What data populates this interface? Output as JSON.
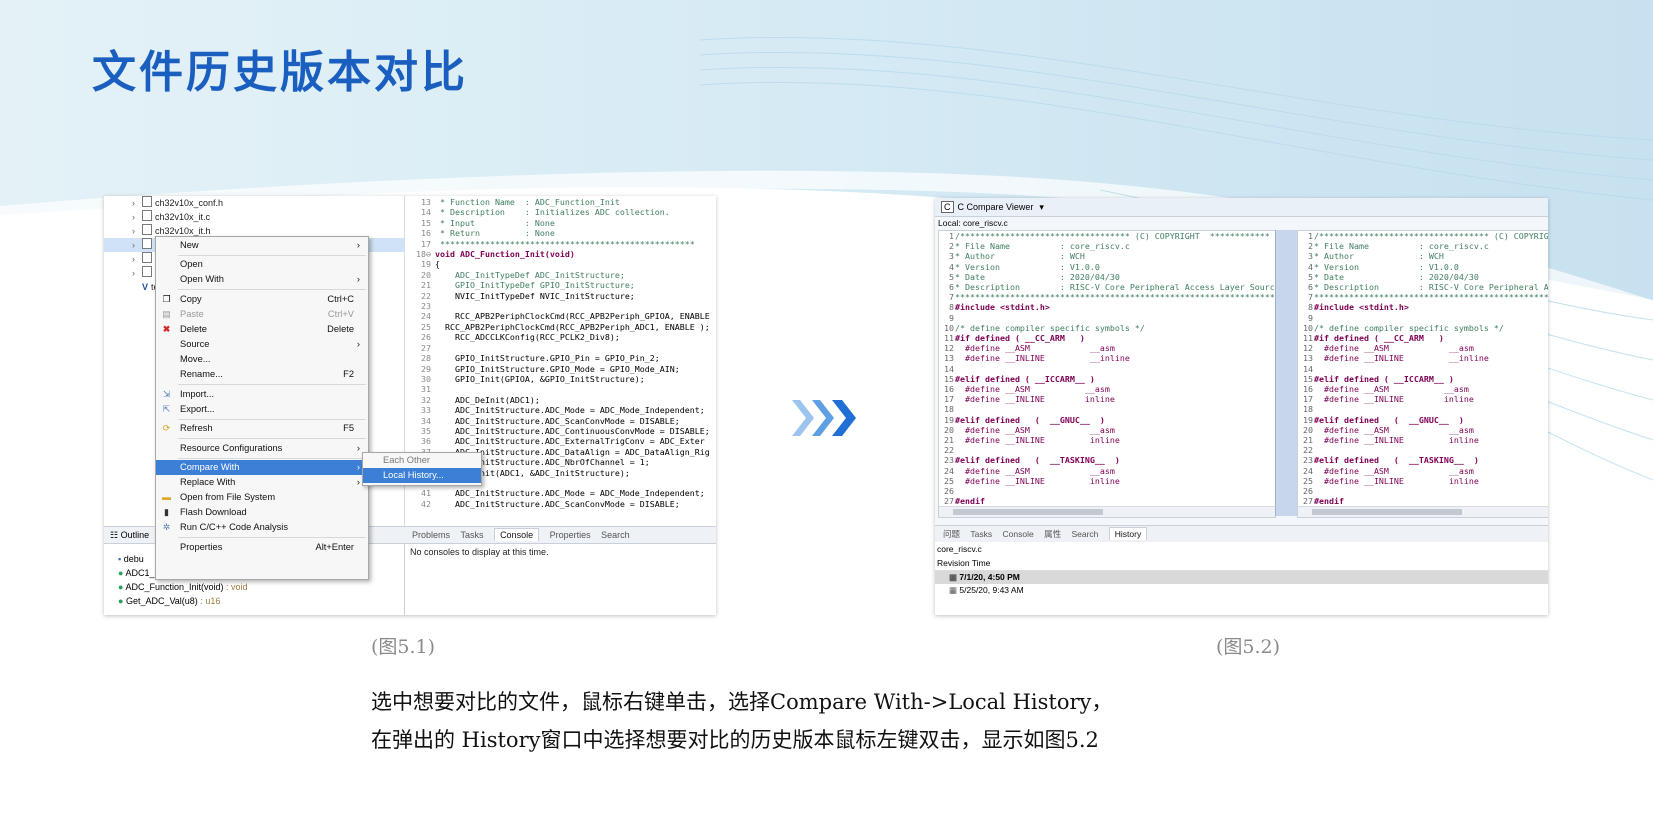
{
  "slide": {
    "title": "文件历史版本对比",
    "caption_left": "(图5.1)",
    "caption_right": "(图5.2)",
    "description_line1": "选中想要对比的文件，鼠标右键单击，选择Compare With->Local History，",
    "description_line2": "在弹出的 History窗口中选择想要对比的历史版本鼠标左键双击，显示如图5.2"
  },
  "shot1": {
    "tree_items": [
      "ch32v10x_conf.h",
      "ch32v10x_it.c",
      "ch32v10x_it.h",
      "r",
      "s",
      "s",
      "tem"
    ],
    "context_menu": {
      "new": "New",
      "open": "Open",
      "open_with": "Open With",
      "copy": "Copy",
      "copy_sc": "Ctrl+C",
      "paste": "Paste",
      "paste_sc": "Ctrl+V",
      "delete": "Delete",
      "delete_sc": "Delete",
      "source": "Source",
      "move": "Move...",
      "rename": "Rename...",
      "rename_sc": "F2",
      "import": "Import...",
      "export": "Export...",
      "refresh": "Refresh",
      "refresh_sc": "F5",
      "resource_configs": "Resource Configurations",
      "compare_with": "Compare With",
      "replace_with": "Replace With",
      "open_file_system": "Open from File System",
      "flash_download": "Flash Download",
      "run_analysis": "Run C/C++ Code Analysis",
      "properties": "Properties",
      "properties_sc": "Alt+Enter"
    },
    "submenu": {
      "each_other": "Each Other",
      "local_history": "Local History..."
    },
    "bottom_tabs": {
      "problems": "Problems",
      "tasks": "Tasks",
      "console": "Console",
      "properties": "Properties",
      "search": "Search"
    },
    "console_message": "No consoles to display at this time.",
    "outline": {
      "title": "Outline",
      "items": [
        {
          "name": "debu",
          "type": ""
        },
        {
          "name": "ADC1_2_IRQHandler(void)",
          "type": " : void"
        },
        {
          "name": "ADC_Function_Init(void)",
          "type": " : void"
        },
        {
          "name": "Get_ADC_Val(u8)",
          "type": " : u16"
        }
      ]
    },
    "code": [
      {
        "n": "13",
        "t": "cm",
        "text": " * Function Name  : ADC_Function_Init"
      },
      {
        "n": "14",
        "t": "cm",
        "text": " * Description    : Initializes ADC collection."
      },
      {
        "n": "15",
        "t": "cm",
        "text": " * Input          : None"
      },
      {
        "n": "16",
        "t": "cm",
        "text": " * Return         : None"
      },
      {
        "n": "17",
        "t": "cm",
        "text": " ***************************************************"
      },
      {
        "n": "18⊖",
        "t": "kw",
        "text": "void ADC_Function_Init(void)"
      },
      {
        "n": "19",
        "t": "",
        "text": "{"
      },
      {
        "n": "20",
        "t": "cm2",
        "text": "    ADC_InitTypeDef ADC_InitStructure;"
      },
      {
        "n": "21",
        "t": "cm2",
        "text": "    GPIO_InitTypeDef GPIO_InitStructure;"
      },
      {
        "n": "22",
        "t": "",
        "text": "    NVIC_InitTypeDef NVIC_InitStructure;"
      },
      {
        "n": "23",
        "t": "",
        "text": ""
      },
      {
        "n": "24",
        "t": "",
        "text": "    RCC_APB2PeriphClockCmd(RCC_APB2Periph_GPIOA, ENABLE"
      },
      {
        "n": "25",
        "t": "",
        "text": "  RCC_APB2PeriphClockCmd(RCC_APB2Periph_ADC1, ENABLE );"
      },
      {
        "n": "26",
        "t": "",
        "text": "    RCC_ADCCLKConfig(RCC_PCLK2_Div8);"
      },
      {
        "n": "27",
        "t": "",
        "text": ""
      },
      {
        "n": "28",
        "t": "",
        "text": "    GPIO_InitStructure.GPIO_Pin = GPIO_Pin_2;"
      },
      {
        "n": "29",
        "t": "",
        "text": "    GPIO_InitStructure.GPIO_Mode = GPIO_Mode_AIN;"
      },
      {
        "n": "30",
        "t": "",
        "text": "    GPIO_Init(GPIOA, &GPIO_InitStructure);"
      },
      {
        "n": "31",
        "t": "",
        "text": ""
      },
      {
        "n": "32",
        "t": "",
        "text": "    ADC_DeInit(ADC1);"
      },
      {
        "n": "33",
        "t": "",
        "text": "    ADC_InitStructure.ADC_Mode = ADC_Mode_Independent;"
      },
      {
        "n": "34",
        "t": "",
        "text": "    ADC_InitStructure.ADC_ScanConvMode = DISABLE;"
      },
      {
        "n": "35",
        "t": "",
        "text": "    ADC_InitStructure.ADC_ContinuousConvMode = DISABLE;"
      },
      {
        "n": "36",
        "t": "",
        "text": "    ADC_InitStructure.ADC_ExternalTrigConv = ADC_Exter"
      },
      {
        "n": "37",
        "t": "",
        "text": "    ADC_InitStructure.ADC_DataAlign = ADC_DataAlign_Rig"
      },
      {
        "n": "38",
        "t": "",
        "text": "    ADC_InitStructure.ADC_NbrOfChannel = 1;"
      },
      {
        "n": "39",
        "t": "",
        "text": "    ADC_Init(ADC1, &ADC_InitStructure);"
      },
      {
        "n": "40",
        "t": "",
        "text": ""
      },
      {
        "n": "41",
        "t": "",
        "text": "    ADC_InitStructure.ADC_Mode = ADC_Mode_Independent;"
      },
      {
        "n": "42",
        "t": "",
        "text": "    ADC_InitStructure.ADC_ScanConvMode = DISABLE;"
      }
    ]
  },
  "shot2": {
    "viewer_title": "C Compare Viewer",
    "local_label": "Local: core_riscv.c",
    "code": [
      {
        "n": "1",
        "t": "cm",
        "text": "/********************************** (C) COPYRIGHT  ************"
      },
      {
        "n": "2",
        "t": "cm",
        "text": "* File Name          : core_riscv.c"
      },
      {
        "n": "3",
        "t": "cm",
        "text": "* Author             : WCH"
      },
      {
        "n": "4",
        "t": "cm",
        "text": "* Version            : V1.0.0"
      },
      {
        "n": "5",
        "t": "cm",
        "text": "* Date               : 2020/04/30"
      },
      {
        "n": "6",
        "t": "cm",
        "text": "* Description        : RISC-V Core Peripheral Access Layer Source"
      },
      {
        "n": "7",
        "t": "cm",
        "text": "*****************************************************************"
      },
      {
        "n": "8",
        "t": "inc",
        "text": "#include <stdint.h>"
      },
      {
        "n": "9",
        "t": "",
        "text": ""
      },
      {
        "n": "10",
        "t": "cm",
        "text": "/* define compiler specific symbols */"
      },
      {
        "n": "11",
        "t": "pp",
        "text": "#if defined ( __CC_ARM   )"
      },
      {
        "n": "12",
        "t": "def",
        "text": "  #define __ASM            __asm"
      },
      {
        "n": "13",
        "t": "def",
        "text": "  #define __INLINE         __inline"
      },
      {
        "n": "14",
        "t": "",
        "text": ""
      },
      {
        "n": "15",
        "t": "pp",
        "text": "#elif defined ( __ICCARM__ )"
      },
      {
        "n": "16",
        "t": "def",
        "text": "  #define __ASM           __asm"
      },
      {
        "n": "17",
        "t": "def",
        "text": "  #define __INLINE        inline"
      },
      {
        "n": "18",
        "t": "",
        "text": ""
      },
      {
        "n": "19",
        "t": "pp",
        "text": "#elif defined   (  __GNUC__  )"
      },
      {
        "n": "20",
        "t": "def",
        "text": "  #define __ASM            __asm"
      },
      {
        "n": "21",
        "t": "def",
        "text": "  #define __INLINE         inline"
      },
      {
        "n": "22",
        "t": "",
        "text": ""
      },
      {
        "n": "23",
        "t": "pp",
        "text": "#elif defined   (  __TASKING__  )"
      },
      {
        "n": "24",
        "t": "def",
        "text": "  #define __ASM            __asm"
      },
      {
        "n": "25",
        "t": "def",
        "text": "  #define __INLINE         inline"
      },
      {
        "n": "26",
        "t": "",
        "text": ""
      },
      {
        "n": "27",
        "t": "pp",
        "text": "#endif"
      },
      {
        "n": "28",
        "t": "",
        "text": ""
      }
    ],
    "tabs": {
      "problems": "问题",
      "tasks": "Tasks",
      "console": "Console",
      "properties": "属性",
      "search": "Search",
      "history": "History"
    },
    "history_file": "core_riscv.c",
    "revision_header": "Revision Time",
    "revisions": [
      "7/1/20, 4:50 PM",
      "5/25/20, 9:43 AM"
    ]
  }
}
